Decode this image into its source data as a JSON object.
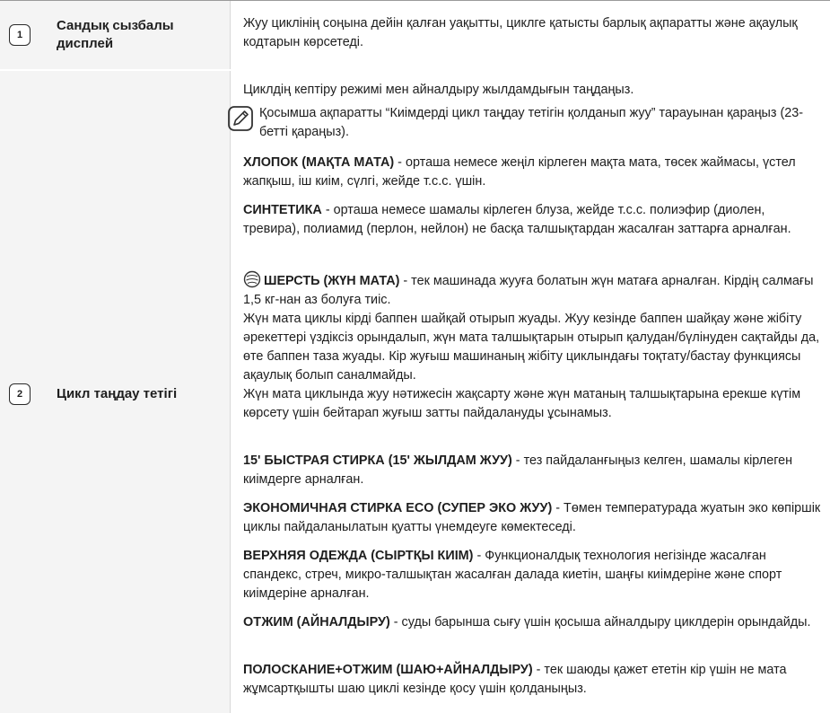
{
  "rows": [
    {
      "number": "1",
      "label": "Сандық сызбалы дисплей",
      "description": "Жуу циклінің соңына дейін қалған уақытты, циклге қатысты барлық ақпаратты және ақаулық кодтарын көрсетеді."
    },
    {
      "number": "2",
      "label": "Цикл таңдау тетігі",
      "intro": "Циклдің кептіру режимі мен айналдыру жылдамдығын таңдаңыз.",
      "note": "Қосымша ақпаратты “Киімдерді цикл таңдау тетігін қолданып жуу” тарауынан қараңыз (23-бетті қараңыз).",
      "items": [
        {
          "name": "ХЛОПОК (МАҚТА МАТА)",
          "text": " - орташа немесе жеңіл кірлеген мақта мата, төсек жаймасы, үстел жапқыш, іш киім, сүлгі, жейде т.с.с. үшін."
        },
        {
          "name": "СИНТЕТИКА",
          "text": " - орташа немесе шамалы кірлеген блуза, жейде т.с.с. полиэфир (диолен, тревира), полиамид (перлон, нейлон) не басқа талшықтардан жасалған заттарға арналған."
        },
        {
          "name": "ШЕРСТЬ (ЖҮН МАТА)",
          "text": " - тек машинада жууға болатын жүн матаға арналған. Кірдің салмағы 1,5 кг-нан аз болуға тиіс.",
          "extra1": "Жүн мата циклы кірді баппен шайқай отырып жуады. Жуу кезінде баппен шайқау және жібіту әрекеттері үздіксіз орындалып, жүн мата талшықтарын отырып қалудан/бүлінуден сақтайды да, өте баппен таза жуады. Кір жуғыш машинаның жібіту циклындағы тоқтату/бастау функциясы ақаулық болып саналмайды.",
          "extra2": "Жүн мата циклында жуу нәтижесін жақсарту және жүн матаның талшықтарына ерекше күтім көрсету үшін бейтарап жуғыш затты пайдалануды ұсынамыз."
        },
        {
          "name": "15' БЫСТРАЯ СТИРКА (15' ЖЫЛДАМ ЖУУ)",
          "text": " - тез пайдаланғыңыз келген, шамалы кірлеген киімдерге арналған."
        },
        {
          "name": "ЭКОНОМИЧНАЯ СТИРКА ECO (СУПЕР ЭКО ЖУУ)",
          "text": " - Төмен температурада жуатын эко көпіршік циклы пайдаланылатын қуатты үнемдеуге көмектеседі."
        },
        {
          "name": "ВЕРХНЯЯ ОДЕЖДА (СЫРТҚЫ КИІМ)",
          "text": " - Функционалдық технология негізінде жасалған спандекс, стреч, микро-талшықтан жасалған далада киетін, шаңғы киімдеріне және спорт киімдеріне арналған."
        },
        {
          "name": "ОТЖИМ (АЙНАЛДЫРУ)",
          "text": " - суды барынша сығу үшін қосыша айналдыру циклдерін орындайды."
        },
        {
          "name": "ПОЛОСКАНИЕ+ОТЖИМ (ШАЮ+АЙНАЛДЫРУ)",
          "text": " - тек шаюды қажет ететін кір үшін не мата жұмсартқышты шаю циклі кезінде қосу үшін қолданыңыз."
        }
      ]
    }
  ],
  "icons": {
    "note": "note-pencil-icon",
    "wool": "wool-ball-icon"
  }
}
